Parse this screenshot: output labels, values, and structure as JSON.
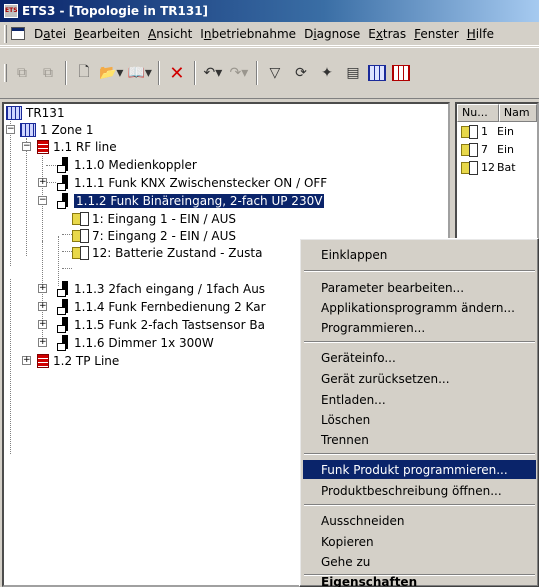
{
  "window": {
    "title": "ETS3 - [Topologie in TR131]",
    "app_icon": "ETS"
  },
  "menu": [
    {
      "pre": "D",
      "u": "a",
      "post": "tei"
    },
    {
      "pre": "",
      "u": "B",
      "post": "earbeiten"
    },
    {
      "pre": "",
      "u": "A",
      "post": "nsicht"
    },
    {
      "pre": "I",
      "u": "n",
      "post": "betriebnahme"
    },
    {
      "pre": "D",
      "u": "i",
      "post": "agnose"
    },
    {
      "pre": "E",
      "u": "x",
      "post": "tras"
    },
    {
      "pre": "",
      "u": "F",
      "post": "enster"
    },
    {
      "pre": "",
      "u": "H",
      "post": "ilfe"
    }
  ],
  "toolbar": {
    "icons": [
      "copy-disabled-icon",
      "paste-disabled-icon",
      "new-icon",
      "open-icon",
      "library-icon",
      "delete-icon",
      "undo-icon",
      "redo-icon",
      "filter-icon",
      "refresh-icon",
      "find-icon",
      "catalog-icon",
      "topology-icon",
      "building-icon"
    ]
  },
  "tree": {
    "root": "TR131",
    "nodes": [
      {
        "text": "1 Zone 1"
      },
      {
        "text": "1.1 RF line"
      },
      {
        "text": "1.1.0 Medienkoppler"
      },
      {
        "text": "1.1.1 Funk KNX Zwischenstecker ON / OFF"
      },
      {
        "text": "1.1.2 Funk Binäreingang, 2-fach UP 230V"
      },
      {
        "text": "1: Eingang 1 - EIN / AUS"
      },
      {
        "text": "7: Eingang 2 - EIN / AUS"
      },
      {
        "text": "12: Batterie Zustand - Zusta"
      },
      {
        "text": "1.1.3 2fach eingang / 1fach Aus"
      },
      {
        "text": "1.1.4 Funk Fernbedienung 2 Kar"
      },
      {
        "text": "1.1.5 Funk 2-fach Tastsensor Ba"
      },
      {
        "text": "1.1.6 Dimmer 1x 300W"
      },
      {
        "text": "1.2 TP Line"
      }
    ]
  },
  "right_pane": {
    "headers": [
      "Nu...",
      "Nam"
    ],
    "rows": [
      {
        "num": "1",
        "name": "Ein"
      },
      {
        "num": "7",
        "name": "Ein"
      },
      {
        "num": "12",
        "name": "Bat"
      }
    ]
  },
  "context_menu": {
    "items": [
      "Einklappen",
      "Parameter bearbeiten...",
      "Applikationsprogramm ändern...",
      "Programmieren...",
      "Geräteinfo...",
      "Gerät zurücksetzen...",
      "Entladen...",
      "Löschen",
      "Trennen",
      "Funk Produkt programmieren...",
      "Produktbeschreibung öffnen...",
      "Ausschneiden",
      "Kopieren",
      "Gehe zu",
      "Eigenschaften"
    ],
    "highlighted_index": 9
  }
}
